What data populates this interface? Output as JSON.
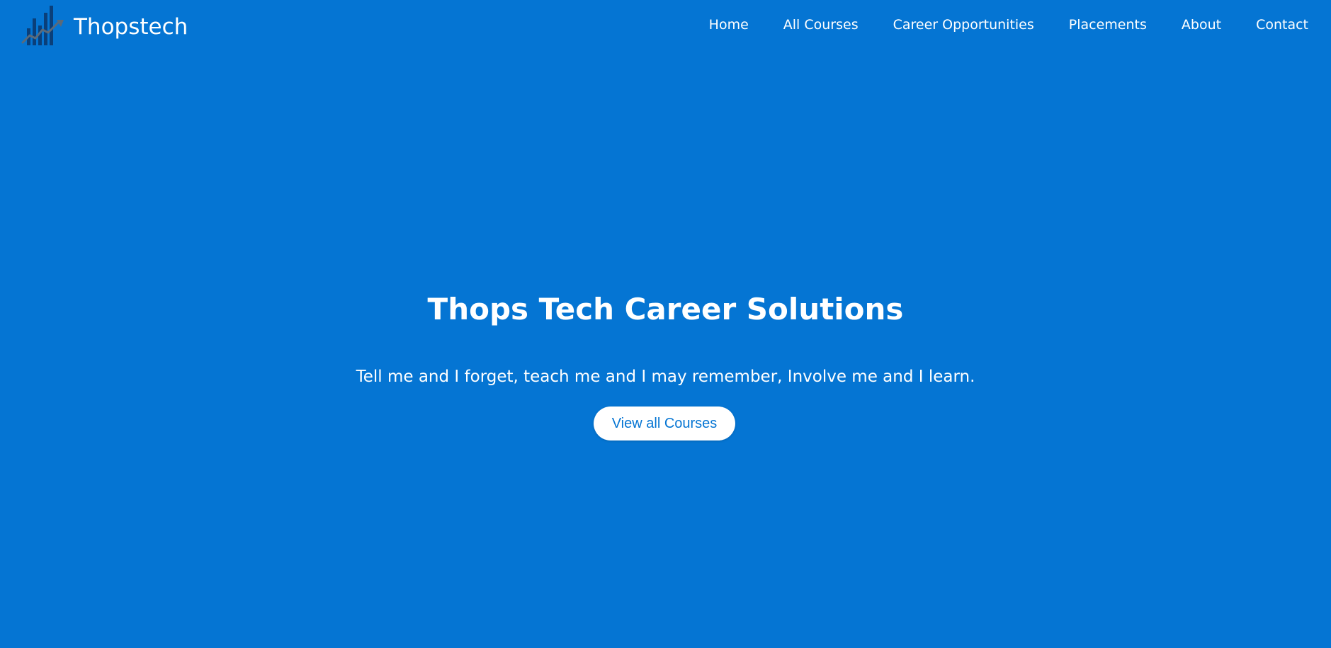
{
  "colors": {
    "background": "#0575d3",
    "text": "#ffffff",
    "button_bg": "#ffffff",
    "button_text": "#0575d3",
    "logo_dark": "#0a3f7a",
    "logo_arrow": "#5a6a7a"
  },
  "navbar": {
    "brand": {
      "logo_icon": "bar-chart-growth-icon",
      "name": "Thopstech"
    },
    "links": [
      {
        "label": "Home"
      },
      {
        "label": "All Courses"
      },
      {
        "label": "Career Opportunities"
      },
      {
        "label": "Placements"
      },
      {
        "label": "About"
      },
      {
        "label": "Contact"
      }
    ]
  },
  "hero": {
    "title": "Thops Tech Career Solutions",
    "subtitle": "Tell me and I forget, teach me and I may remember, Involve me and I learn.",
    "button_label": "View all Courses"
  }
}
